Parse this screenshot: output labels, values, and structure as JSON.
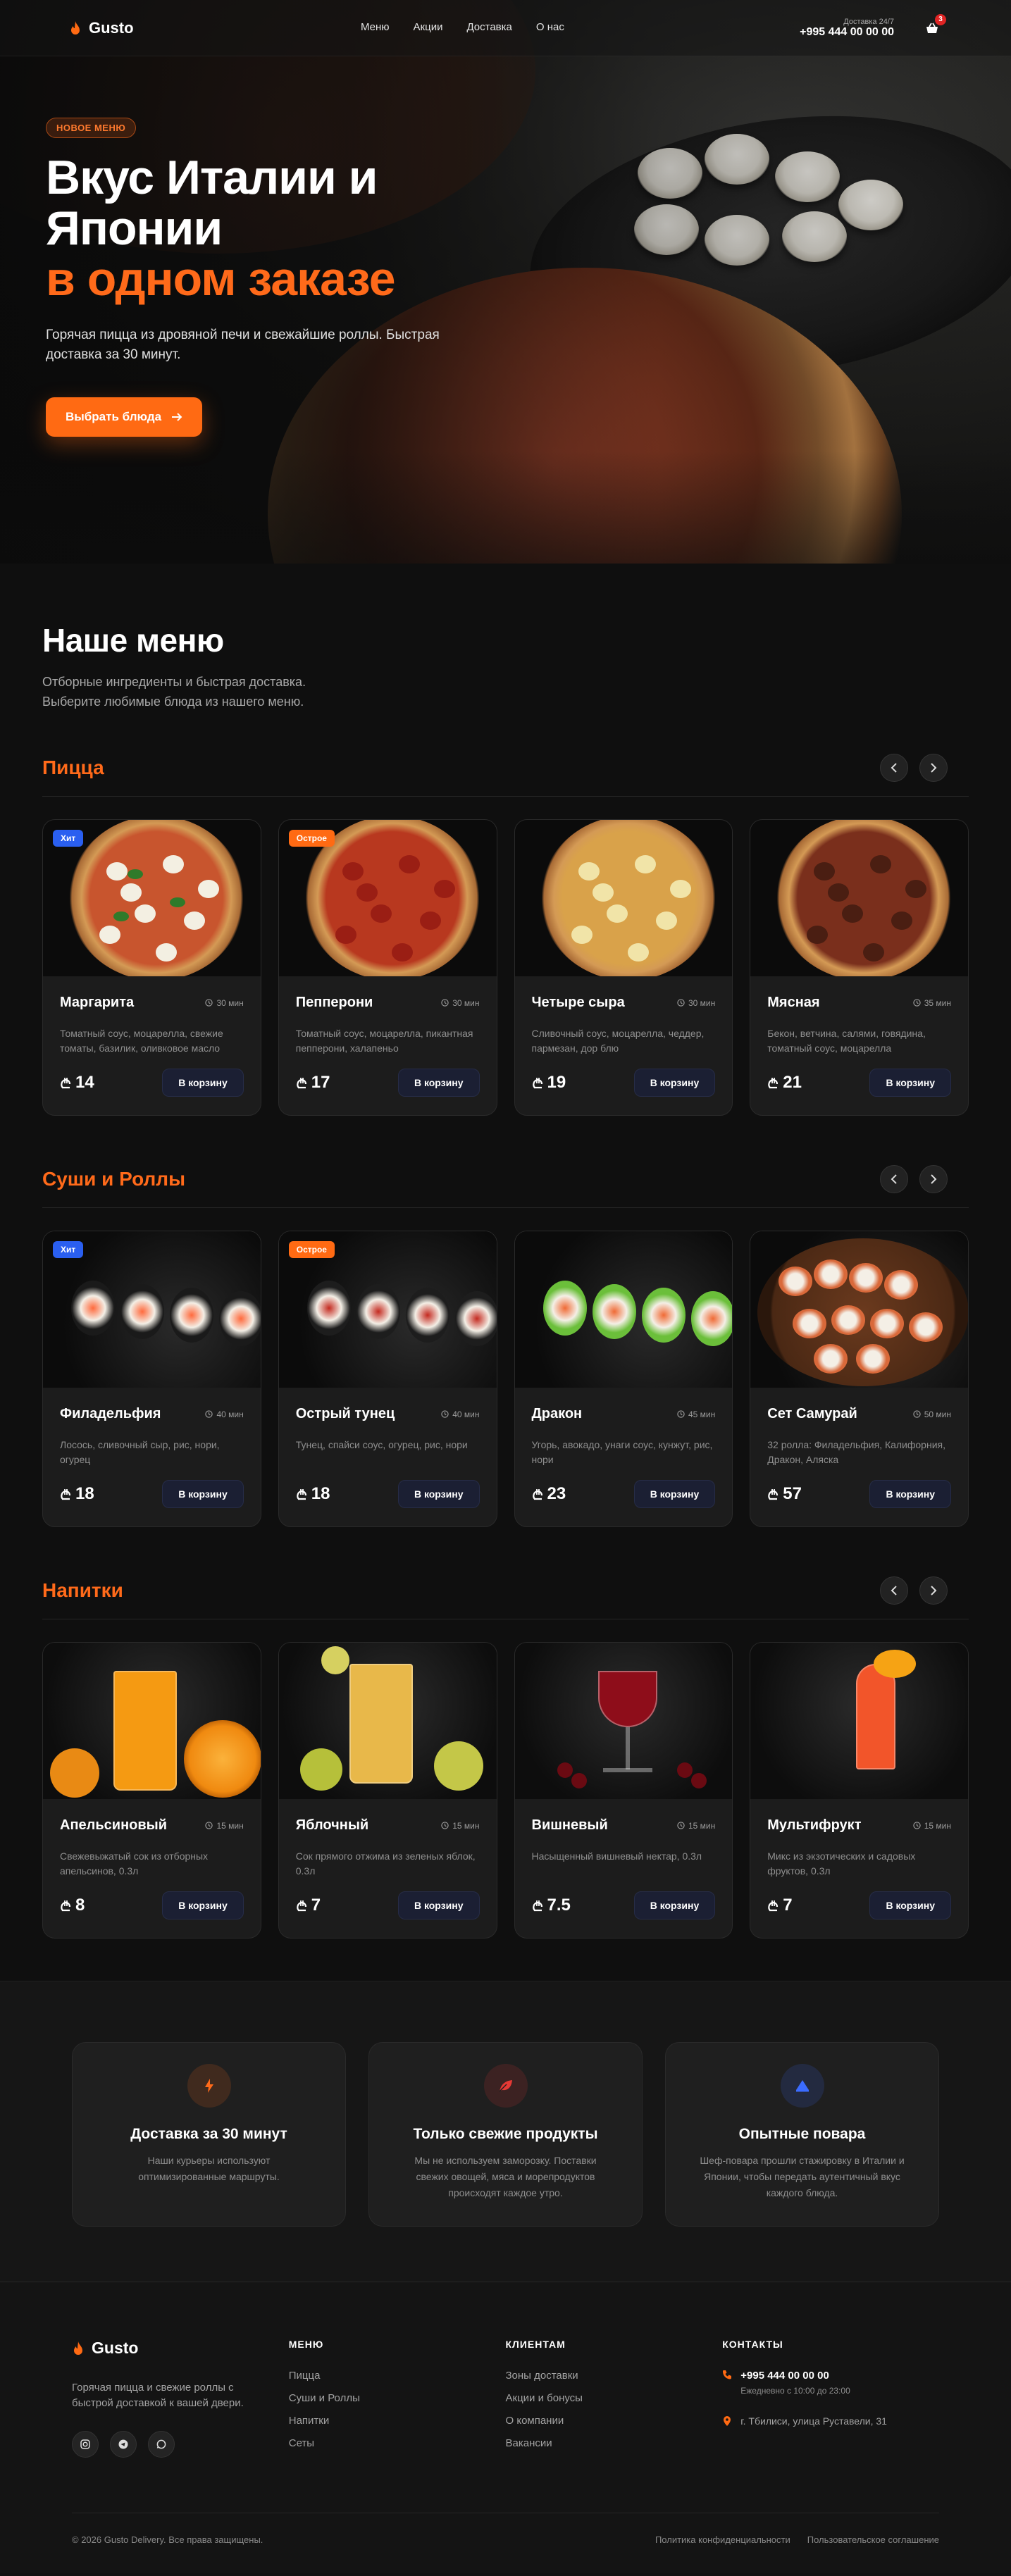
{
  "header": {
    "brand": "Gusto",
    "nav": [
      "Меню",
      "Акции",
      "Доставка",
      "О нас"
    ],
    "phone_sub": "Доставка 24/7",
    "phone": "+995 444 00 00 00",
    "cart_count": "3",
    "cart_icon": "basket-icon"
  },
  "hero": {
    "badge": "НОВОЕ МЕНЮ",
    "title_line1": "Вкус Италии и",
    "title_line2": "Японии",
    "title_accent": "в одном заказе",
    "desc": "Горячая пицца из дровяной печи и свежайшие роллы. Быстрая доставка за 30 минут.",
    "button": "Выбрать блюда"
  },
  "menu": {
    "title": "Наше меню",
    "subtitle": "Отборные ингредиенты и быстрая доставка. Выберите любимые блюда из нашего меню.",
    "buy_label": "В корзину",
    "categories": [
      {
        "title": "Пицца",
        "items": [
          {
            "name": "Маргарита",
            "time": "30 мин",
            "desc": "Томатный соус, моцарелла, свежие томаты, базилик, оливковое масло",
            "price": "14",
            "tag": "Хит"
          },
          {
            "name": "Пепперони",
            "time": "30 мин",
            "desc": "Томатный соус, моцарелла, пикантная пепперони, халапеньо",
            "price": "17",
            "tag": "Острое"
          },
          {
            "name": "Четыре сыра",
            "time": "30 мин",
            "desc": "Сливочный соус, моцарелла, чеддер, пармезан, дор блю",
            "price": "19",
            "tag": ""
          },
          {
            "name": "Мясная",
            "time": "35 мин",
            "desc": "Бекон, ветчина, салями, говядина, томатный соус, моцарелла",
            "price": "21",
            "tag": ""
          }
        ]
      },
      {
        "title": "Суши и Роллы",
        "items": [
          {
            "name": "Филадельфия",
            "time": "40 мин",
            "desc": "Лосось, сливочный сыр, рис, нори, огурец",
            "price": "18",
            "tag": "Хит"
          },
          {
            "name": "Острый тунец",
            "time": "40 мин",
            "desc": "Тунец, спайси соус, огурец, рис, нори",
            "price": "18",
            "tag": "Острое"
          },
          {
            "name": "Дракон",
            "time": "45 мин",
            "desc": "Угорь, авокадо, унаги соус, кунжут, рис, нори",
            "price": "23",
            "tag": ""
          },
          {
            "name": "Сет Самурай",
            "time": "50 мин",
            "desc": "32 ролла: Филадельфия, Калифорния, Дракон, Аляска",
            "price": "57",
            "tag": ""
          }
        ]
      },
      {
        "title": "Напитки",
        "items": [
          {
            "name": "Апельсиновый",
            "time": "15 мин",
            "desc": "Свежевыжатый сок из отборных апельсинов, 0.3л",
            "price": "8",
            "tag": ""
          },
          {
            "name": "Яблочный",
            "time": "15 мин",
            "desc": "Сок прямого отжима из зеленых яблок, 0.3л",
            "price": "7",
            "tag": ""
          },
          {
            "name": "Вишневый",
            "time": "15 мин",
            "desc": "Насыщенный вишневый нектар, 0.3л",
            "price": "7.5",
            "tag": ""
          },
          {
            "name": "Мультифрукт",
            "time": "15 мин",
            "desc": "Микс из экзотических и садовых фруктов, 0.3л",
            "price": "7",
            "tag": ""
          }
        ]
      }
    ]
  },
  "features": [
    {
      "title": "Доставка за 30 минут",
      "text": "Наши курьеры используют оптимизированные маршруты.",
      "icon": "lightning-icon",
      "color": "#ff6a1a"
    },
    {
      "title": "Только свежие продукты",
      "text": "Мы не используем заморозку. Поставки свежих овощей, мяса и морепродуктов происходят каждое утро.",
      "icon": "leaf-icon",
      "color": "#e53935"
    },
    {
      "title": "Опытные повара",
      "text": "Шеф-повара прошли стажировку в Италии и Японии, чтобы передать аутентичный вкус каждого блюда.",
      "icon": "chef-hat-icon",
      "color": "#3b6cff"
    }
  ],
  "footer": {
    "brand": "Gusto",
    "about": "Горячая пицца и свежие роллы с быстрой доставкой к вашей двери.",
    "menu_title": "МЕНЮ",
    "menu_links": [
      "Пицца",
      "Суши и Роллы",
      "Напитки",
      "Сеты"
    ],
    "clients_title": "КЛИЕНТАМ",
    "clients_links": [
      "Зоны доставки",
      "Акции и бонусы",
      "О компании",
      "Вакансии"
    ],
    "contacts_title": "КОНТАКТЫ",
    "phone": "+995 444 00 00 00",
    "hours": "Ежедневно с 10:00 до 23:00",
    "address": "г. Тбилиси, улица Руставели, 31",
    "copyright": "© 2026 Gusto Delivery. Все права защищены.",
    "privacy": "Политика конфиденциальности",
    "terms": "Пользовательское соглашение"
  },
  "colors": {
    "accent": "#ff6a13",
    "hit": "#2a5ff0",
    "bg": "#0f0f0f"
  }
}
